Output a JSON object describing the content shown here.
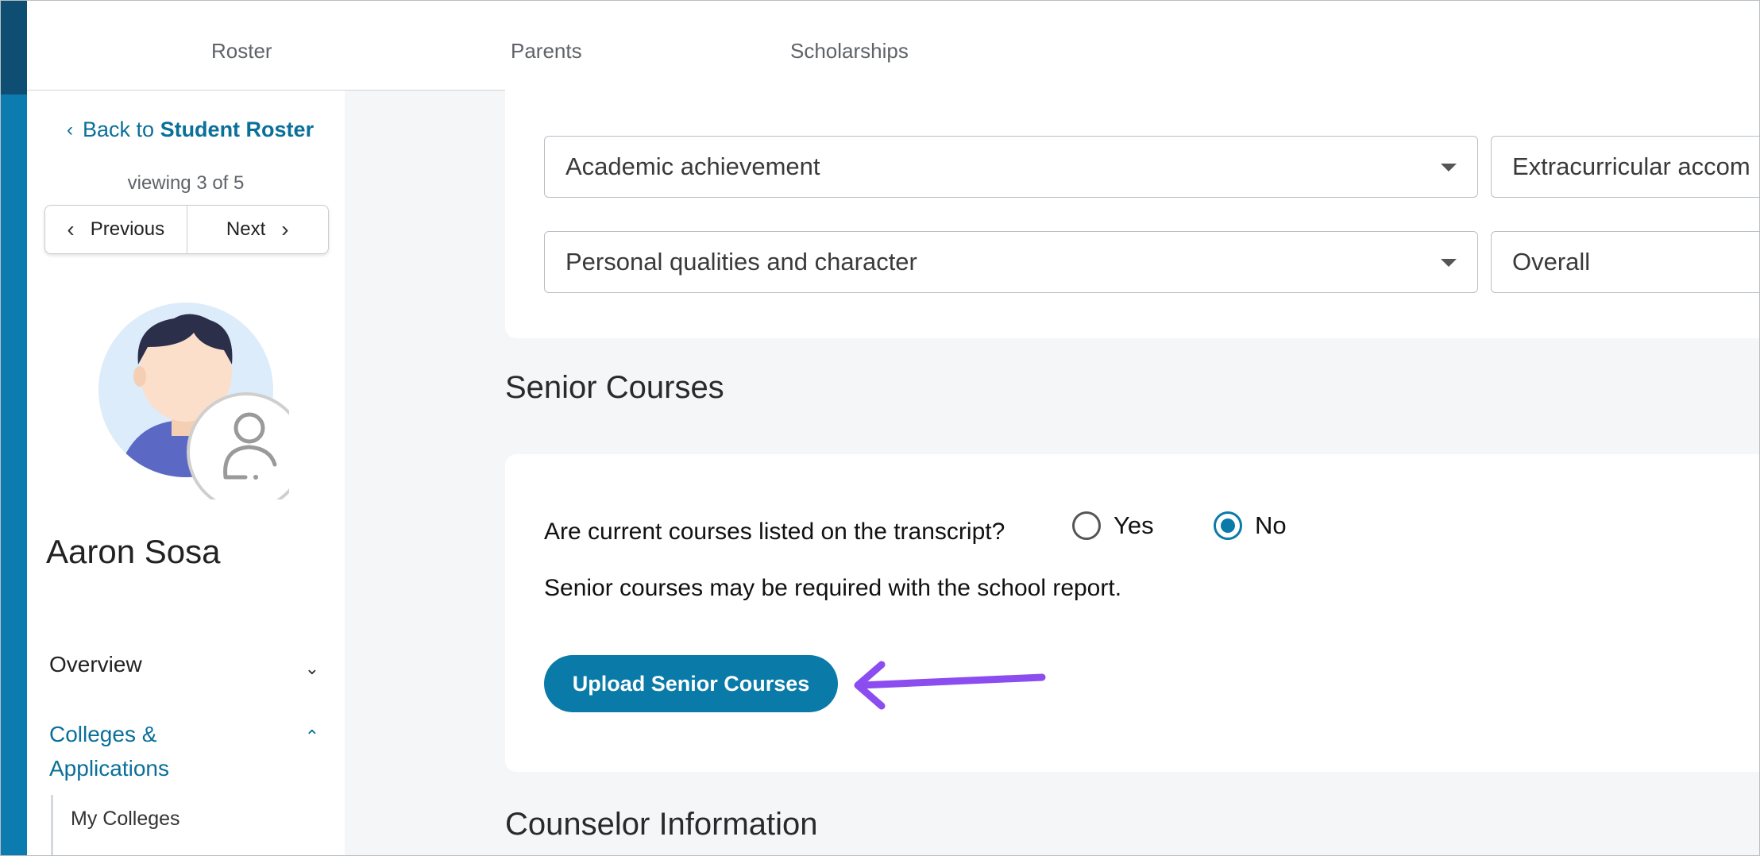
{
  "topnav": {
    "tabs": [
      {
        "label": "Roster"
      },
      {
        "label": "Parents"
      },
      {
        "label": "Scholarships"
      }
    ]
  },
  "sidebar": {
    "back_prefix": "Back to",
    "back_target": "Student Roster",
    "viewing": "viewing 3 of 5",
    "prev_label": "Previous",
    "next_label": "Next",
    "student_name": "Aaron Sosa",
    "nav": [
      {
        "label": "Overview",
        "expanded": false
      },
      {
        "label": "Colleges & Applications",
        "expanded": true
      }
    ],
    "subnav": [
      {
        "label": "My Colleges"
      }
    ]
  },
  "main": {
    "selects": [
      {
        "value": "Academic achievement"
      },
      {
        "value": "Extracurricular accom"
      },
      {
        "value": "Personal qualities and character"
      },
      {
        "value": "Overall"
      }
    ],
    "senior_courses": {
      "title": "Senior Courses",
      "question": "Are current courses listed on the transcript?",
      "options": [
        {
          "label": "Yes",
          "checked": false
        },
        {
          "label": "No",
          "checked": true
        }
      ],
      "note": "Senior courses may be required with the school report.",
      "upload_label": "Upload Senior Courses"
    },
    "counselor_title": "Counselor Information"
  },
  "colors": {
    "accent": "#0a7aa8",
    "arrow": "#8b4df0",
    "strip": "#0c7bb0"
  }
}
